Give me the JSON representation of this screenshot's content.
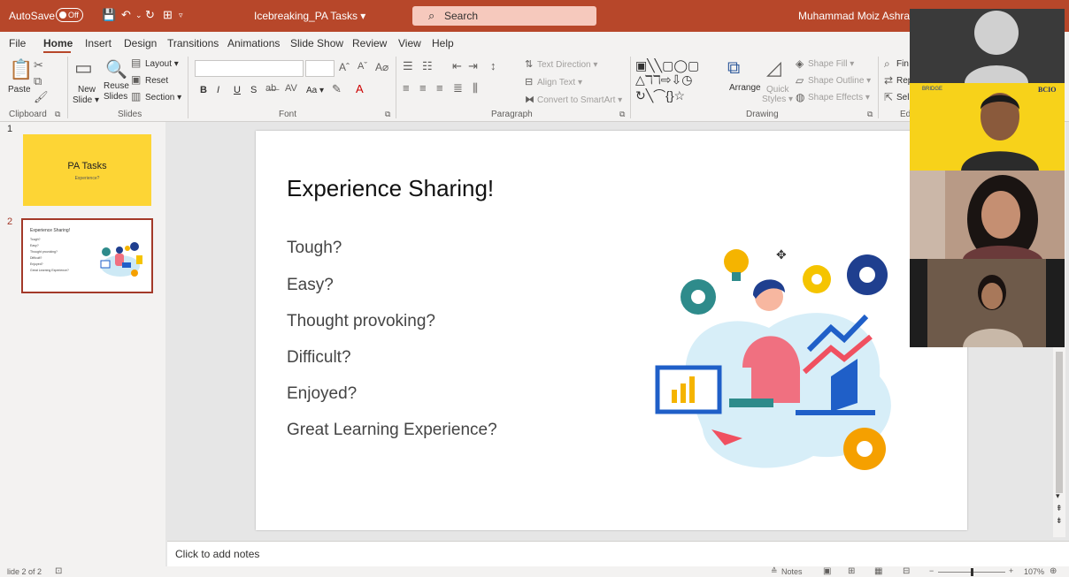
{
  "titlebar": {
    "autosave_label": "AutoSave",
    "autosave_state": "Off",
    "document_name": "Icebreaking_PA Tasks ▾",
    "search_placeholder": "Search",
    "user_name": "Muhammad Moiz Ashraf Qazi"
  },
  "menu": {
    "tabs": [
      "File",
      "Home",
      "Insert",
      "Design",
      "Transitions",
      "Animations",
      "Slide Show",
      "Review",
      "View",
      "Help"
    ],
    "active_tab": "Home"
  },
  "ribbon": {
    "clipboard": {
      "label": "Clipboard",
      "paste": "Paste"
    },
    "slides": {
      "label": "Slides",
      "new_slide": "New",
      "new_slide_2": "Slide ▾",
      "reuse": "Reuse",
      "reuse_2": "Slides",
      "layout": "Layout ▾",
      "reset": "Reset",
      "section": "Section ▾"
    },
    "font": {
      "label": "Font",
      "bold": "B",
      "italic": "I",
      "underline": "U",
      "strike": "S",
      "case": "Aa ▾"
    },
    "paragraph": {
      "label": "Paragraph",
      "text_direction": "Text Direction ▾",
      "align_text": "Align Text ▾",
      "convert_smartart": "Convert to SmartArt ▾"
    },
    "drawing": {
      "label": "Drawing",
      "arrange": "Arrange",
      "quick_styles": "Quick",
      "quick_styles_2": "Styles ▾",
      "shape_fill": "Shape Fill ▾",
      "shape_outline": "Shape Outline ▾",
      "shape_effects": "Shape Effects ▾"
    },
    "editing": {
      "label": "Ed",
      "find": "Fin",
      "replace": "Rep",
      "select": "Sel"
    }
  },
  "thumbnails": [
    {
      "number": "1",
      "title": "PA Tasks",
      "subtitle": "Experience?"
    },
    {
      "number": "2",
      "title": "Experience Sharing!",
      "items": [
        "Tough?",
        "Easy?",
        "Thought provoking?",
        "Difficult?",
        "Enjoyed?",
        "Great Learning Experience?"
      ]
    }
  ],
  "slide": {
    "heading": "Experience Sharing!",
    "items": [
      "Tough?",
      "Easy?",
      "Thought provoking?",
      "Difficult?",
      "Enjoyed?",
      "Great Learning Experience?"
    ]
  },
  "notes_placeholder": "Click to add notes",
  "statusbar": {
    "slide_info": "lide 2 of 2",
    "notes_label": "Notes",
    "zoom_minus": "−",
    "zoom_plus": "+",
    "zoom_level": "107%"
  },
  "video": {
    "banner_left": "BRIDGE",
    "banner_right": "BCIO"
  },
  "colors": {
    "accent": "#b7472a",
    "slide1_bg": "#fdd535",
    "thumb_border": "#a33929"
  }
}
